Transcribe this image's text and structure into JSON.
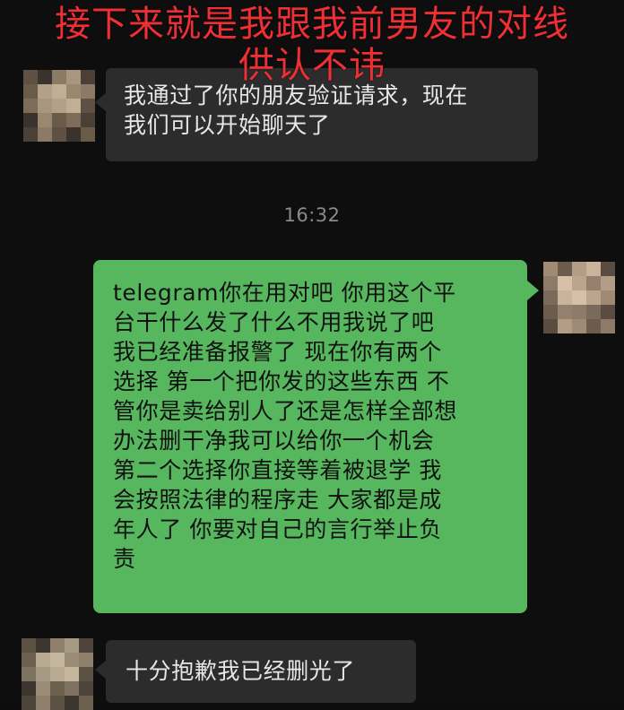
{
  "caption": {
    "line1": "接下来就是我跟我前男友的对线",
    "line2": "供认不讳"
  },
  "messages": [
    {
      "sender": "contact",
      "text": "我通过了你的朋友验证请求，现在\n我们可以开始聊天了"
    },
    {
      "sender": "me",
      "text": "telegram你在用对吧 你用这个平\n台干什么发了什么不用我说了吧\n我已经准备报警了 现在你有两个\n选择 第一个把你发的这些东西 不\n管你是卖给别人了还是怎样全部想\n办法删干净我可以给你一个机会\n第二个选择你直接等着被退学 我\n会按照法律的程序走 大家都是成\n年人了 你要对自己的言行举止负\n责"
    },
    {
      "sender": "contact",
      "text": "十分抱歉我已经删光了"
    }
  ],
  "timestamp": "16:32",
  "colors": {
    "background": "#0e0e0e",
    "caption": "#ee2f34",
    "incoming_bubble": "#2c2c2c",
    "outgoing_bubble": "#57b75e"
  },
  "avatars": {
    "contact": "pixelated-avatar",
    "me": "pixelated-avatar"
  }
}
